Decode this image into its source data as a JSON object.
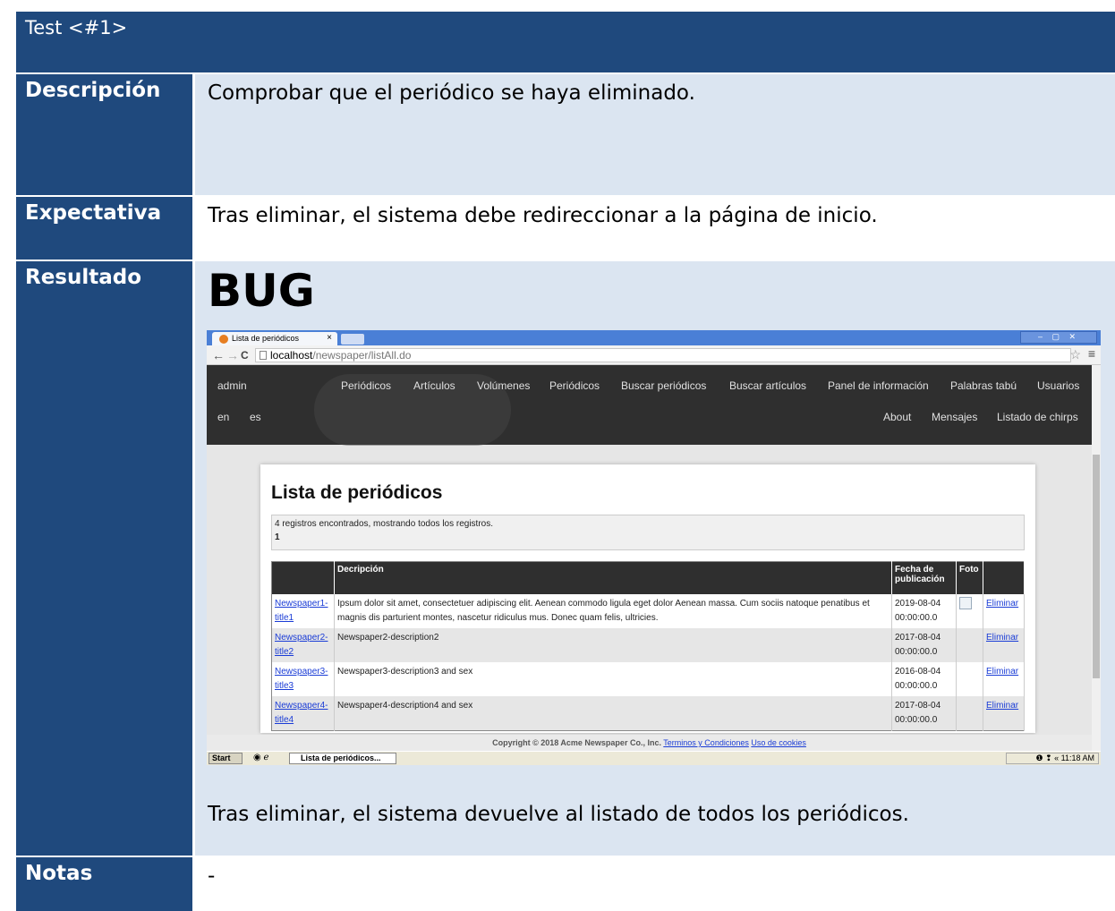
{
  "header": {
    "title": "Test <#1>"
  },
  "rows": {
    "descripcion": {
      "label": "Descripción",
      "value": "Comprobar que el periódico se haya eliminado."
    },
    "expectativa": {
      "label": "Expectativa",
      "value": "Tras eliminar, el sistema debe redireccionar a la página de inicio."
    },
    "resultado": {
      "label": "Resultado",
      "status": "BUG",
      "caption": "Tras eliminar, el sistema devuelve al listado de todos los periódicos."
    },
    "notas": {
      "label": "Notas",
      "value": "-"
    }
  },
  "browser": {
    "tab_title": "Lista de periódicos",
    "tab_close": "×",
    "window_controls": "– ▢ ✕",
    "back": "←",
    "forward": "→",
    "reload": "C",
    "url_host": "localhost",
    "url_path": "/newspaper/listAll.do",
    "star": "☆",
    "menu": "≡"
  },
  "site_nav": {
    "user": "admin",
    "items_row1": [
      "Periódicos",
      "Artículos",
      "Volúmenes",
      "Periódicos",
      "Buscar periódicos",
      "Buscar artículos",
      "Panel de información",
      "Palabras tabú",
      "Usuarios"
    ],
    "lang_en": "en",
    "lang_es": "es",
    "items_row2": [
      "About",
      "Mensajes",
      "Listado de chirps"
    ]
  },
  "page": {
    "title": "Lista de periódicos",
    "records_info": "4 registros encontrados, mostrando todos los registros.",
    "page_number": "1",
    "columns": [
      "",
      "Decripción",
      "Fecha de publicación",
      "Foto",
      ""
    ],
    "rows": [
      {
        "title": "Newspaper1-title1",
        "description": "Ipsum dolor sit amet, consectetuer adipiscing elit. Aenean commodo ligula eget dolor Aenean massa. Cum sociis natoque penatibus et magnis dis parturient montes, nascetur ridiculus mus. Donec quam felis, ultricies.",
        "date": "2019-08-04 00:00:00.0",
        "action": "Eliminar"
      },
      {
        "title": "Newspaper2-title2",
        "description": "Newspaper2-description2",
        "date": "2017-08-04 00:00:00.0",
        "action": "Eliminar"
      },
      {
        "title": "Newspaper3-title3",
        "description": "Newspaper3-description3 and sex",
        "date": "2016-08-04 00:00:00.0",
        "action": "Eliminar"
      },
      {
        "title": "Newspaper4-title4",
        "description": "Newspaper4-description4 and sex",
        "date": "2017-08-04 00:00:00.0",
        "action": "Eliminar"
      }
    ],
    "footer_copyright": "Copyright © 2018 Acme Newspaper Co., Inc.",
    "footer_terms": "Terminos y Condiciones",
    "footer_cookies": "Uso de cookies"
  },
  "taskbar": {
    "start": "Start",
    "quicklaunch": "◉ ℯ",
    "active_window": "Lista de periódicos...",
    "tray_icons": "❶ ❢ «",
    "clock": "11:18 AM"
  }
}
